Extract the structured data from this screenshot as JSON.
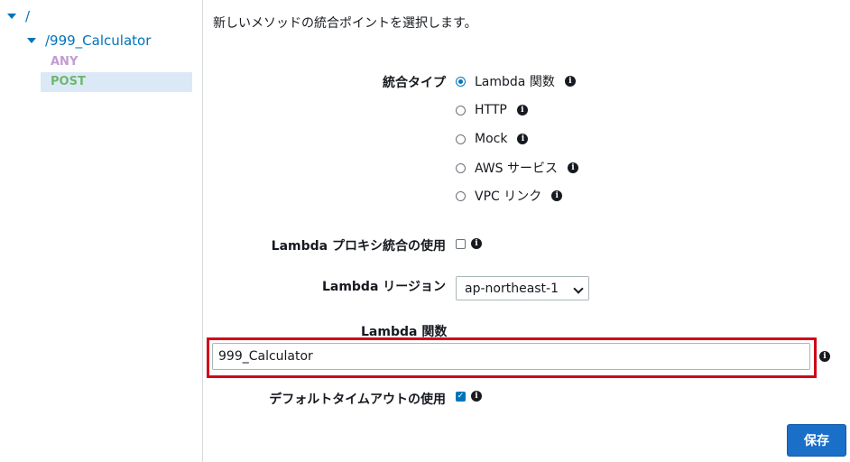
{
  "tree": {
    "root": "/",
    "resource": "/999_Calculator",
    "methods": [
      "ANY",
      "POST"
    ]
  },
  "intro": "新しいメソッドの統合ポイントを選択します。",
  "integration_type": {
    "label": "統合タイプ",
    "options": [
      "Lambda 関数",
      "HTTP",
      "Mock",
      "AWS サービス",
      "VPC リンク"
    ],
    "selected": "Lambda 関数"
  },
  "proxy": {
    "label": "Lambda プロキシ統合の使用",
    "checked": false
  },
  "region": {
    "label": "Lambda リージョン",
    "value": "ap-northeast-1"
  },
  "function": {
    "label": "Lambda 関数",
    "value": "999_Calculator"
  },
  "timeout": {
    "label": "デフォルトタイムアウトの使用",
    "checked": true
  },
  "save_label": "保存",
  "info_glyph": "i"
}
